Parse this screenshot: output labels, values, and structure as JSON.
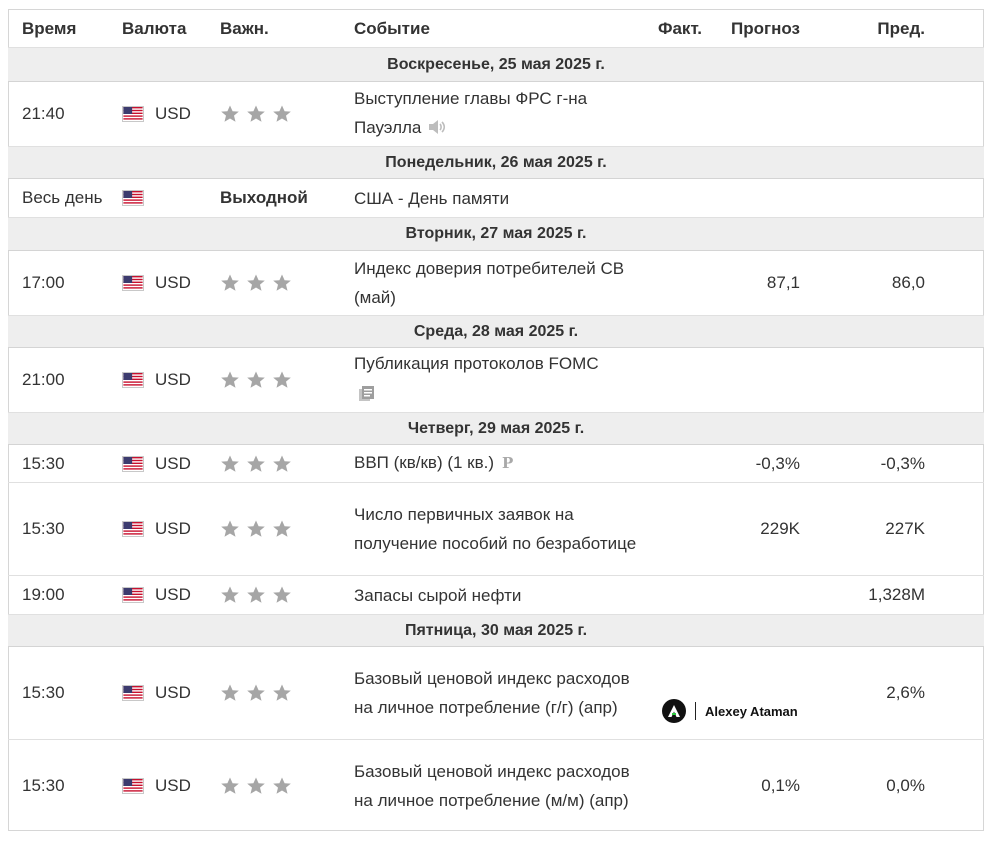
{
  "header": {
    "time": "Время",
    "currency": "Валюта",
    "importance": "Важн.",
    "event": "Событие",
    "actual": "Факт.",
    "forecast": "Прогноз",
    "previous": "Пред."
  },
  "days": [
    {
      "title": "Воскресенье, 25 мая 2025 г.",
      "events": [
        {
          "time": "21:40",
          "currency": "USD",
          "importance": 3,
          "event": "Выступление главы ФРС г-на Пауэлла",
          "icon": "speaker-icon",
          "actual": "",
          "forecast": "",
          "previous": ""
        }
      ]
    },
    {
      "title": "Понедельник, 26 мая 2025 г.",
      "events": [
        {
          "time": "Весь день",
          "currency": "",
          "importance_label": "Выходной",
          "event": "США - День памяти",
          "actual": "",
          "forecast": "",
          "previous": ""
        }
      ]
    },
    {
      "title": "Вторник, 27 мая 2025 г.",
      "events": [
        {
          "time": "17:00",
          "currency": "USD",
          "importance": 3,
          "event": "Индекс доверия потребителей CB (май)",
          "actual": "",
          "forecast": "87,1",
          "previous": "86,0"
        }
      ]
    },
    {
      "title": "Среда, 28 мая 2025 г.",
      "events": [
        {
          "time": "21:00",
          "currency": "USD",
          "importance": 3,
          "event": "Публикация протоколов FOMC",
          "icon": "document-icon",
          "actual": "",
          "forecast": "",
          "previous": ""
        }
      ]
    },
    {
      "title": "Четверг, 29 мая 2025 г.",
      "events": [
        {
          "time": "15:30",
          "currency": "USD",
          "importance": 3,
          "event": "ВВП (кв/кв) (1 кв.)",
          "icon": "preliminary-icon",
          "actual": "",
          "forecast": "-0,3%",
          "previous": "-0,3%"
        },
        {
          "time": "15:30",
          "currency": "USD",
          "importance": 3,
          "event": "Число первичных заявок на получение пособий по безработице",
          "actual": "",
          "forecast": "229K",
          "previous": "227K"
        },
        {
          "time": "19:00",
          "currency": "USD",
          "importance": 3,
          "event": "Запасы сырой нефти",
          "actual": "",
          "forecast": "",
          "previous": "1,328M"
        }
      ]
    },
    {
      "title": "Пятница, 30 мая 2025 г.",
      "events": [
        {
          "time": "15:30",
          "currency": "USD",
          "importance": 3,
          "event": "Базовый ценовой индекс расходов на личное потребление (г/г) (апр)",
          "actual": "",
          "forecast": "",
          "previous": "2,6%"
        },
        {
          "time": "15:30",
          "currency": "USD",
          "importance": 3,
          "event": "Базовый ценовой индекс расходов на личное потребление (м/м) (апр)",
          "actual": "",
          "forecast": "0,1%",
          "previous": "0,0%"
        }
      ]
    }
  ],
  "watermark": {
    "text": "Alexey Ataman"
  },
  "colors": {
    "star": "#a6a6a6",
    "day_bg": "#eeeeee",
    "border": "#e0e0e0",
    "flag_red": "#c8102e",
    "flag_blue": "#3c3b6e"
  }
}
